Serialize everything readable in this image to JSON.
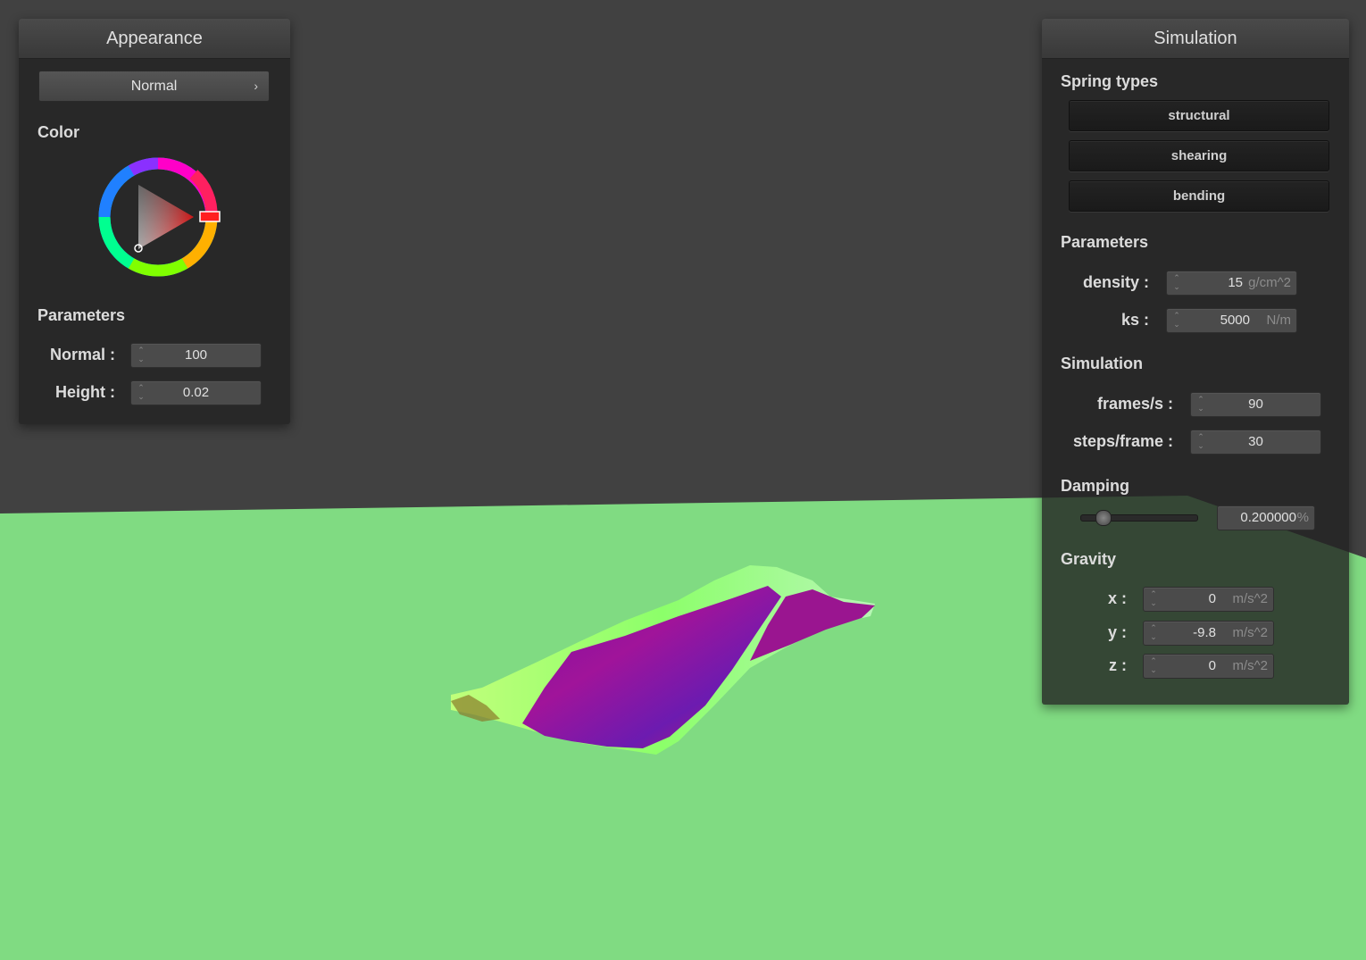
{
  "colors": {
    "background": "#414141",
    "floor": "#80db82",
    "cloth_primary": "#8a12a8",
    "cloth_secondary": "#7dff6a",
    "color_wheel_selected": "#ff2020"
  },
  "appearance": {
    "title": "Appearance",
    "shader_popup": {
      "label": "Normal",
      "chevron": "›"
    },
    "color_label": "Color",
    "parameters_label": "Parameters",
    "normal": {
      "label": "Normal :",
      "value": "100"
    },
    "height": {
      "label": "Height :",
      "value": "0.02"
    }
  },
  "simulation_panel": {
    "title": "Simulation",
    "spring_types_label": "Spring types",
    "spring_buttons": [
      "structural",
      "shearing",
      "bending"
    ],
    "parameters_label": "Parameters",
    "density": {
      "label": "density :",
      "value": "15",
      "unit": "g/cm^2"
    },
    "ks": {
      "label": "ks :",
      "value": "5000",
      "unit": "N/m"
    },
    "simulation_label": "Simulation",
    "frames_per_s": {
      "label": "frames/s :",
      "value": "90"
    },
    "steps_per_frame": {
      "label": "steps/frame :",
      "value": "30"
    },
    "damping_label": "Damping",
    "damping": {
      "value": "0.200000",
      "unit": "%",
      "slider_fraction": 0.2
    },
    "gravity_label": "Gravity",
    "gravity": [
      {
        "label": "x :",
        "value": "0",
        "unit": "m/s^2"
      },
      {
        "label": "y :",
        "value": "-9.8",
        "unit": "m/s^2"
      },
      {
        "label": "z :",
        "value": "0",
        "unit": "m/s^2"
      }
    ]
  },
  "icons": {
    "spin_arrows": "⌃⌄",
    "color_wheel": "color-wheel-icon"
  }
}
